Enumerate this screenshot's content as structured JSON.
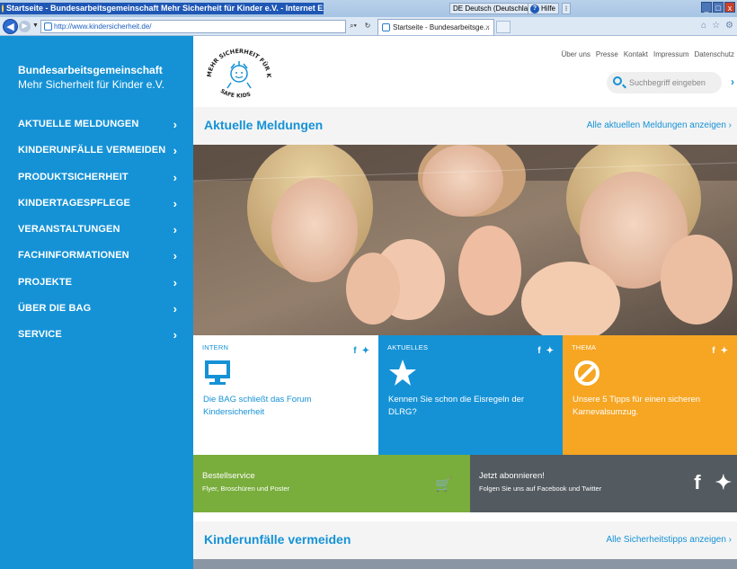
{
  "browser": {
    "window_title": "Startseite - Bundesarbeitsgemeinschaft Mehr Sicherheit für Kinder e.V. - Internet Explorer",
    "language": "DE Deutsch (Deutschland)",
    "help": "Hilfe",
    "url": "http://www.kindersicherheit.de/",
    "tab_title": "Startseite - Bundesarbeitsge...",
    "window_buttons": [
      "_",
      "□",
      "x"
    ]
  },
  "sidebar": {
    "org_line1": "Bundesarbeitsgemeinschaft",
    "org_line2": "Mehr Sicherheit für Kinder e.V.",
    "items": [
      {
        "label": "AKTUELLE MELDUNGEN"
      },
      {
        "label": "KINDERUNFÄLLE VERMEIDEN"
      },
      {
        "label": "PRODUKTSICHERHEIT"
      },
      {
        "label": "KINDERTAGESPFLEGE"
      },
      {
        "label": "VERANSTALTUNGEN"
      },
      {
        "label": "FACHINFORMATIONEN"
      },
      {
        "label": "PROJEKTE"
      },
      {
        "label": "ÜBER DIE BAG"
      },
      {
        "label": "SERVICE"
      }
    ],
    "chevron": "›"
  },
  "header": {
    "logo_text_top": "MEHR SICHERHEIT FÜR KINDER",
    "logo_text_bottom": "SAFE KIDS",
    "links": [
      "Über uns",
      "Presse",
      "Kontakt",
      "Impressum",
      "Datenschutz"
    ],
    "search_placeholder": "Suchbegriff eingeben",
    "search_arrow": "›"
  },
  "news": {
    "heading": "Aktuelle Meldungen",
    "more": "Alle aktuellen Meldungen anzeigen ›"
  },
  "tiles": [
    {
      "category": "INTERN",
      "text": "Die BAG schließt das Forum Kindersicherheit",
      "icon": "monitor-icon"
    },
    {
      "category": "AKTUELLES",
      "text": "Kennen Sie schon die Eisregeln der DLRG?",
      "icon": "star-icon"
    },
    {
      "category": "THEMA",
      "text": "Unsere 5 Tipps für einen sicheren Karnevalsumzug.",
      "icon": "no-entry-icon"
    }
  ],
  "social": {
    "facebook": "f",
    "twitter": "🐦"
  },
  "banners": {
    "order_title": "Bestellservice",
    "order_sub": "Flyer, Broschüren und Poster",
    "subscribe_title": "Jetzt abonnieren!",
    "subscribe_sub": "Folgen Sie uns auf Facebook und Twitter"
  },
  "section2": {
    "heading": "Kinderunfälle vermeiden",
    "more": "Alle Sicherheitstipps anzeigen ›"
  },
  "colors": {
    "brand_blue": "#1592d6",
    "orange": "#f6a623",
    "green": "#79ad3c",
    "dark_grey": "#535a60"
  }
}
